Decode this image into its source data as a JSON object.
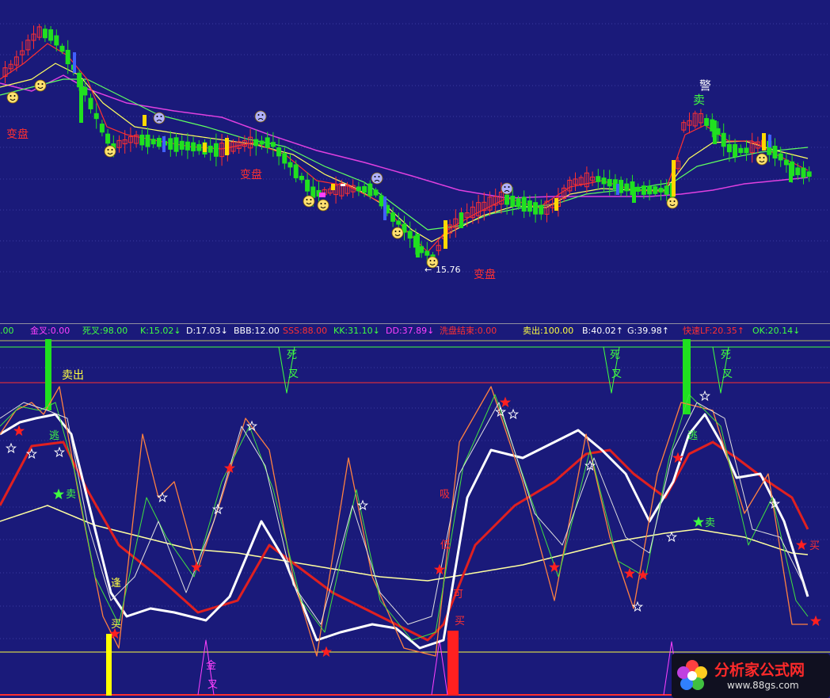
{
  "chart_data": [
    {
      "type": "candlestick",
      "title": "",
      "annotations": {
        "low_price": "15.76",
        "warning_label": "警",
        "sell_label": "卖",
        "change_labels": [
          "变盘",
          "变盘",
          "变盘"
        ]
      },
      "grid": true,
      "series": [
        {
          "name": "",
          "color": "#ff3030",
          "role": "ma-short"
        },
        {
          "name": "",
          "color": "#ffff60",
          "role": "ma-mid"
        },
        {
          "name": "",
          "color": "#60ff60",
          "role": "ma-long"
        },
        {
          "name": "",
          "color": "#e040e0",
          "role": "ma-longest"
        }
      ]
    },
    {
      "type": "line",
      "title": "",
      "legend_items": [
        {
          "text": ".00",
          "color": "#40ff40"
        },
        {
          "text": "金叉:0.00",
          "color": "#ff40ff"
        },
        {
          "text": "死叉:98.00",
          "color": "#40ff40"
        },
        {
          "text": "K:15.02↓",
          "color": "#40ff40"
        },
        {
          "text": "D:17.03↓",
          "color": "#ffffff"
        },
        {
          "text": "BBB:12.00",
          "color": "#ffffff"
        },
        {
          "text": "SSS:88.00",
          "color": "#ff3030"
        },
        {
          "text": "KK:31.10↓",
          "color": "#40ff40"
        },
        {
          "text": "DD:37.89↓",
          "color": "#ff40ff"
        },
        {
          "text": "洗盘结束:0.00",
          "color": "#ff3030"
        },
        {
          "text": "卖出:100.00",
          "color": "#ffff40"
        },
        {
          "text": "B:40.02↑",
          "color": "#ffffff"
        },
        {
          "text": "G:39.98↑",
          "color": "#ffffff"
        },
        {
          "text": "快速LF:20.35↑",
          "color": "#ff3030"
        },
        {
          "text": "OK:20.14↓",
          "color": "#40ff40"
        }
      ],
      "annotations": {
        "sell_out": "卖出",
        "dead_cross": [
          "死",
          "叉",
          "死",
          "叉",
          "死",
          "叉"
        ],
        "golden_cross": [
          "金",
          "叉"
        ],
        "buy": [
          "买",
          "买",
          "买"
        ],
        "sell": [
          "卖",
          "卖"
        ],
        "escape": [
          "逃",
          "逃"
        ],
        "meet": "逢",
        "low": "低",
        "can": "可",
        "suck": "吸"
      }
    }
  ],
  "watermark": {
    "brand": "分析家公式网",
    "site": "www.88gs.com"
  },
  "colors": {
    "background": "#1a1a7a",
    "up": "#ff3030",
    "down": "#20e020",
    "grid": "#3a3aa0"
  }
}
